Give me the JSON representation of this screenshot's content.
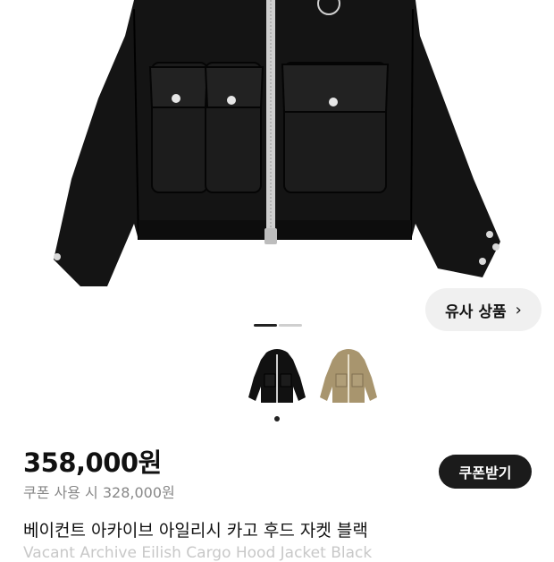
{
  "similar_button": {
    "label": "유사 상품",
    "chevron": "›"
  },
  "gallery": {
    "active_index": 1,
    "total": 2
  },
  "thumbnails": [
    {
      "name": "black jacket",
      "color": "#111111"
    },
    {
      "name": "beige jacket",
      "color": "#a8956e"
    }
  ],
  "price": "358,000원",
  "coupon_price": "쿠폰 사용 시 328,000원",
  "coupon_button": "쿠폰받기",
  "product_title": "베이컨트 아카이브 아일리시 카고 후드 자켓 블랙",
  "product_title_en": "Vacant Archive Eilish Cargo Hood Jacket Black",
  "colors": {
    "dark": "#1b1b1b",
    "muted": "#888888",
    "chip": "#f0f0f0"
  }
}
